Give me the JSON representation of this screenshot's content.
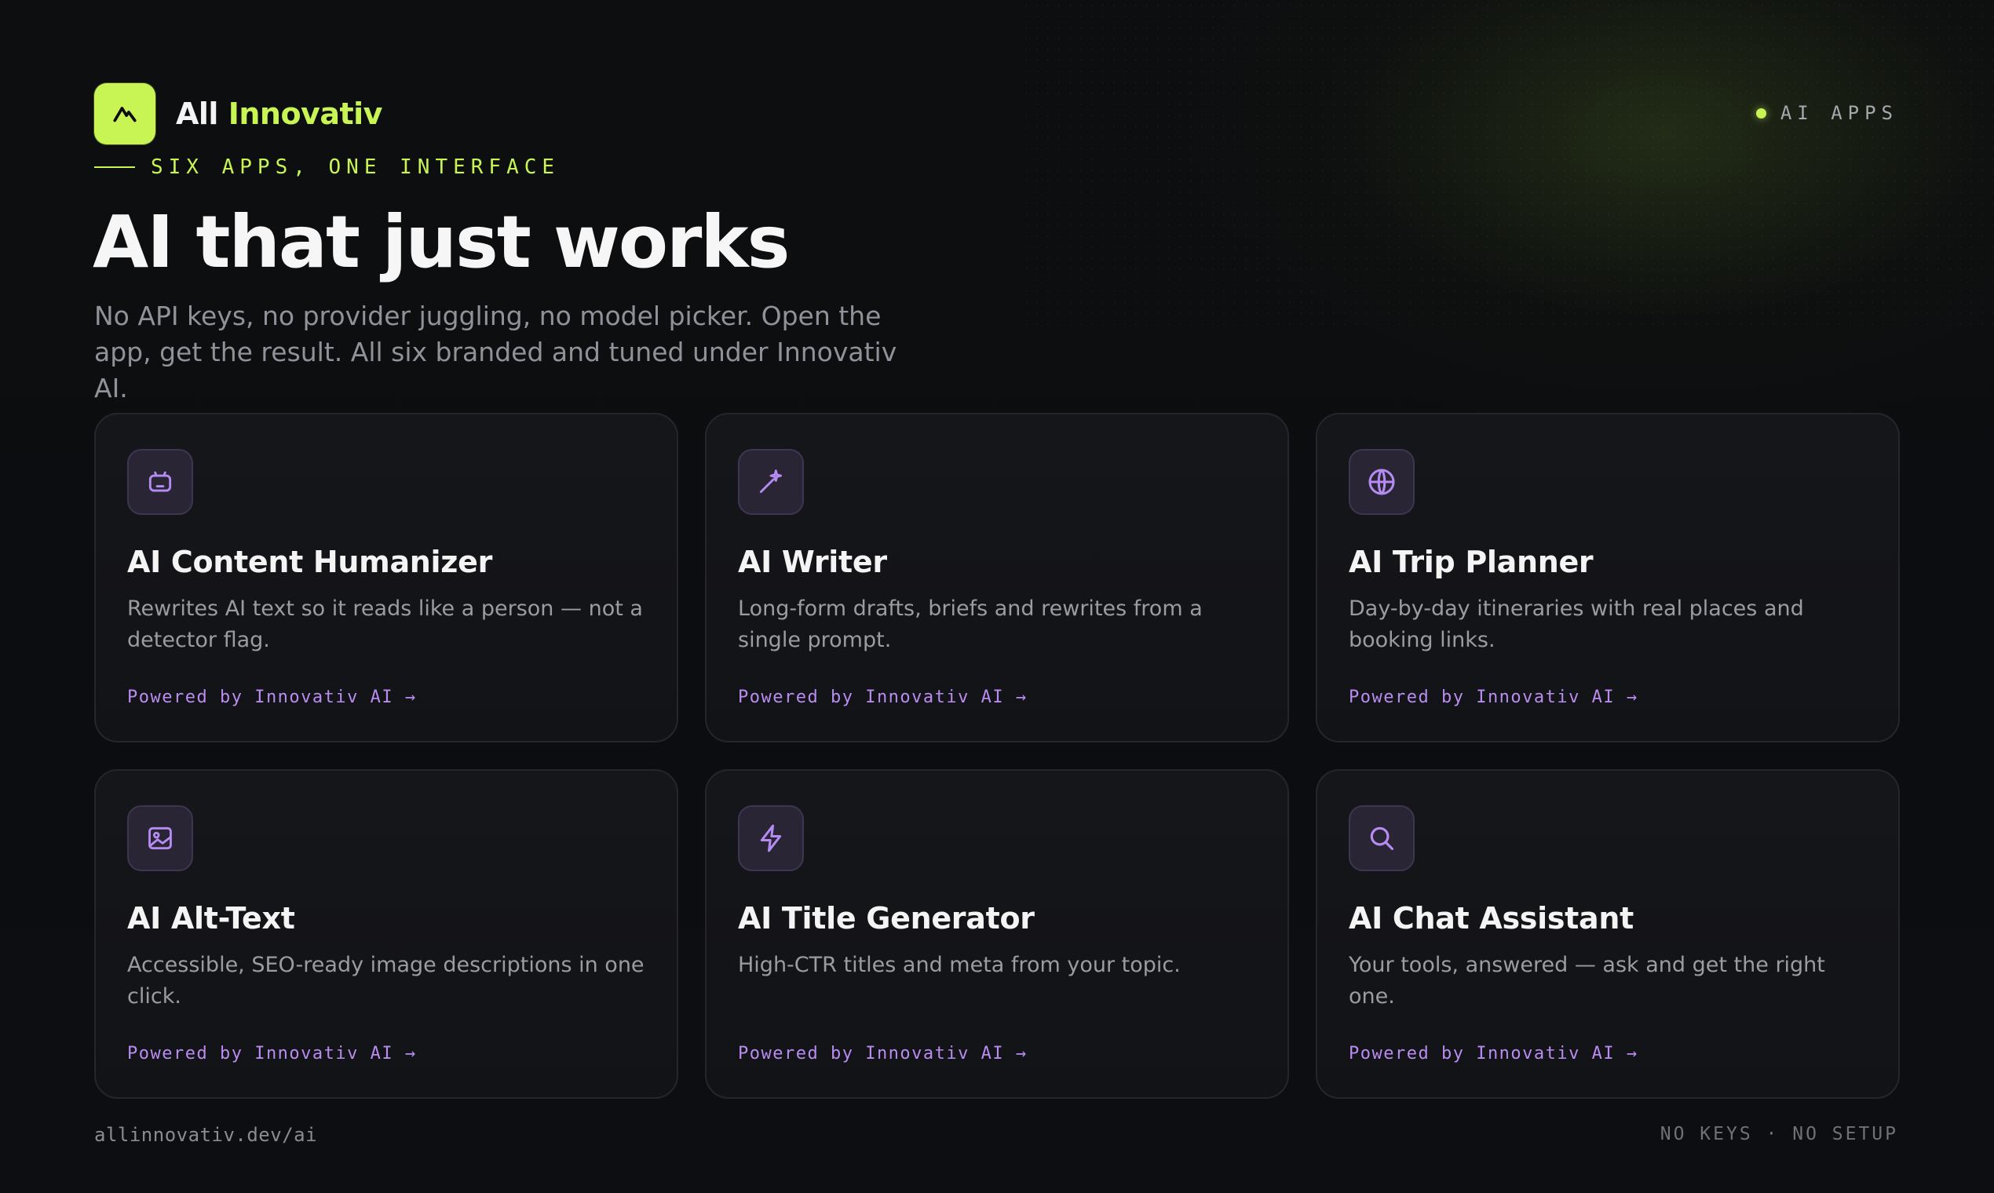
{
  "brand": {
    "name_part1": "All",
    "name_part2": "Innovativ",
    "logo_icon": "mountain-peak-icon",
    "accent_color": "#c8f454"
  },
  "top_badge": {
    "label": "AI APPS"
  },
  "hero": {
    "eyebrow": "SIX APPS, ONE INTERFACE",
    "title": "AI that just works",
    "subtitle": "No API keys, no provider juggling, no model picker. Open the app, get the result. All six branded and tuned under Innovativ AI."
  },
  "apps": [
    {
      "icon": "robot-icon",
      "title": "AI Content Humanizer",
      "description": "Rewrites AI text so it reads like a person — not a detector flag.",
      "link": "Powered by Innovativ AI →"
    },
    {
      "icon": "magic-wand-icon",
      "title": "AI Writer",
      "description": "Long-form drafts, briefs and rewrites from a single prompt.",
      "link": "Powered by Innovativ AI →"
    },
    {
      "icon": "globe-icon",
      "title": "AI Trip Planner",
      "description": "Day-by-day itineraries with real places and booking links.",
      "link": "Powered by Innovativ AI →"
    },
    {
      "icon": "image-icon",
      "title": "AI Alt-Text",
      "description": "Accessible, SEO-ready image descriptions in one click.",
      "link": "Powered by Innovativ AI →"
    },
    {
      "icon": "lightning-icon",
      "title": "AI Title Generator",
      "description": "High-CTR titles and meta from your topic.",
      "link": "Powered by Innovativ AI →"
    },
    {
      "icon": "search-icon",
      "title": "AI Chat Assistant",
      "description": "Your tools, answered — ask and get the right one.",
      "link": "Powered by Innovativ AI →"
    }
  ],
  "footer": {
    "url": "allinnovativ.dev/ai",
    "tagline": "NO KEYS · NO SETUP"
  },
  "colors": {
    "background": "#0b0c0e",
    "accent": "#c8f454",
    "link_purple": "#b98cf0",
    "icon_purple": "#b48cf2"
  }
}
